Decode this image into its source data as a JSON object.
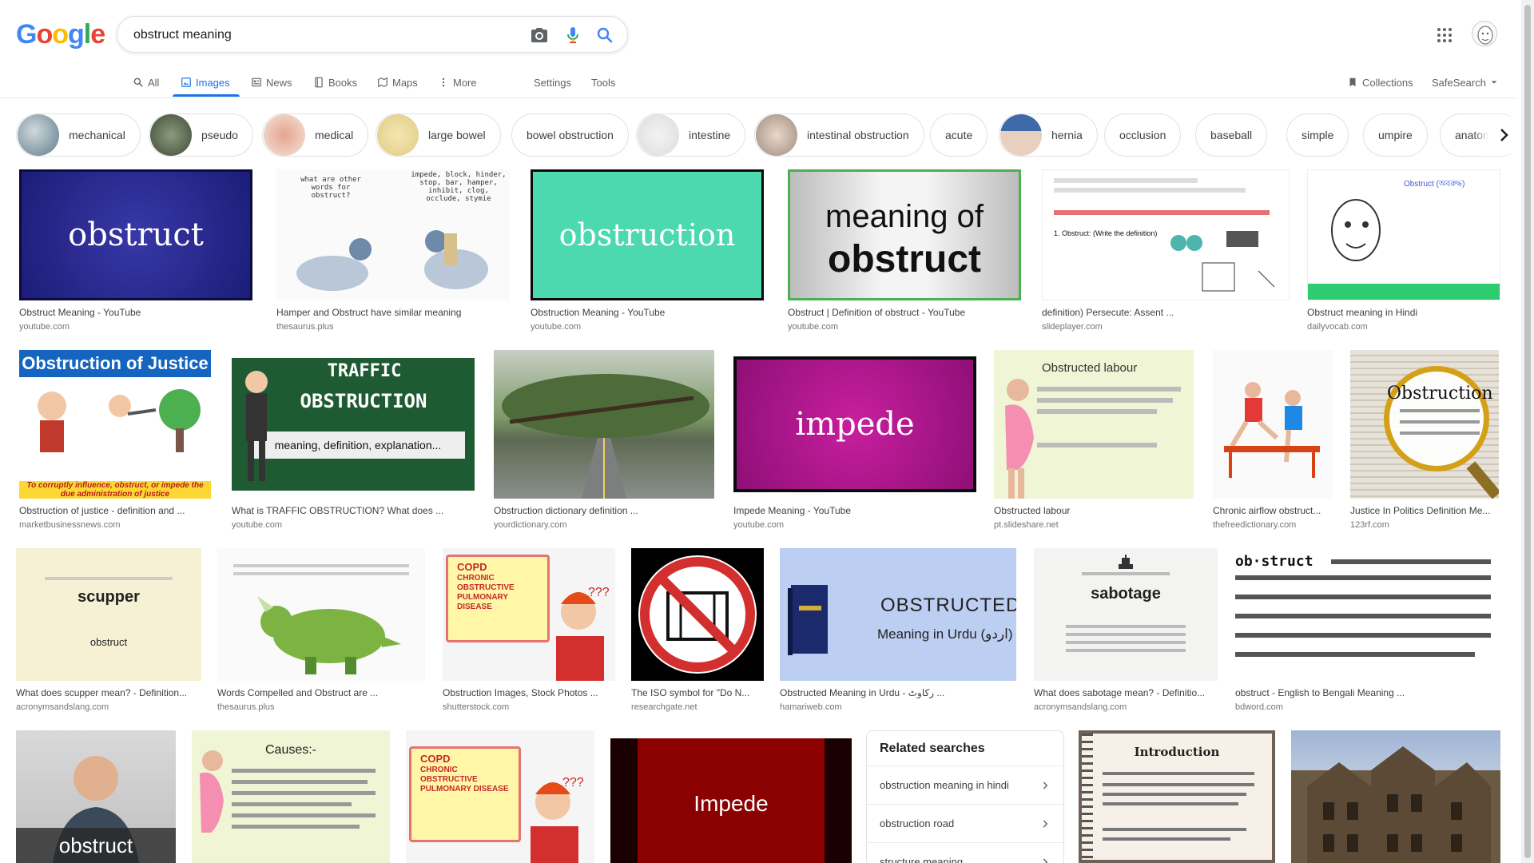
{
  "logo": {
    "text": "Google"
  },
  "search": {
    "query": "obstruct meaning",
    "placeholder": ""
  },
  "nav": {
    "tabs": [
      {
        "label": "All",
        "icon": "search-icon"
      },
      {
        "label": "Images",
        "icon": "image-icon",
        "active": true
      },
      {
        "label": "News",
        "icon": "news-icon"
      },
      {
        "label": "Books",
        "icon": "book-icon"
      },
      {
        "label": "Maps",
        "icon": "map-icon"
      },
      {
        "label": "More",
        "icon": "more-vert-icon"
      }
    ],
    "settings": "Settings",
    "tools": "Tools",
    "collections": "Collections",
    "safesearch": "SafeSearch"
  },
  "chips": [
    {
      "label": "mechanical",
      "thumb": true
    },
    {
      "label": "pseudo",
      "thumb": true
    },
    {
      "label": "medical",
      "thumb": true
    },
    {
      "label": "large bowel",
      "thumb": true
    },
    {
      "label": "bowel obstruction",
      "thumb": false
    },
    {
      "label": "intestine",
      "thumb": true
    },
    {
      "label": "intestinal obstruction",
      "thumb": true
    },
    {
      "label": "acute",
      "thumb": false
    },
    {
      "label": "hernia",
      "thumb": true
    },
    {
      "label": "occlusion",
      "thumb": false
    },
    {
      "label": "baseball",
      "thumb": false
    },
    {
      "label": "simple",
      "thumb": false
    },
    {
      "label": "umpire",
      "thumb": false
    },
    {
      "label": "anatomy p",
      "thumb": false
    }
  ],
  "results": [
    {
      "title": "Obstruct Meaning - YouTube",
      "source": "youtube.com",
      "caption": "obstruct"
    },
    {
      "title": "Hamper and Obstruct have similar meaning",
      "source": "thesaurus.plus",
      "caption": "impede, block, hinder, stop, bar, hamper, inhibit, clog, occlude, stymie",
      "caption2": "what are other words for obstruct?"
    },
    {
      "title": "Obstruction Meaning - YouTube",
      "source": "youtube.com",
      "caption": "obstruction"
    },
    {
      "title": "Obstruct | Definition of obstruct - YouTube",
      "source": "youtube.com",
      "caption": "meaning of",
      "caption2": "obstruct"
    },
    {
      "title": "definition) Persecute: Assent ...",
      "source": "slideplayer.com",
      "caption": "1. Obstruct: (Write the definition)"
    },
    {
      "title": "Obstruct meaning in Hindi",
      "source": "dailyvocab.com",
      "caption": "Obstruct (অবরুদ্ধ)"
    },
    {
      "title": "Obstruction of justice - definition and ...",
      "source": "marketbusinessnews.com",
      "caption": "Obstruction of Justice",
      "caption2": "To corruptly influence, obstruct, or impede the due administration of justice"
    },
    {
      "title": "What is TRAFFIC OBSTRUCTION? What does ...",
      "source": "youtube.com",
      "caption": "TRAFFIC",
      "caption2": "OBSTRUCTION",
      "caption3": "meaning, definition, explanation..."
    },
    {
      "title": "Obstruction dictionary definition ...",
      "source": "yourdictionary.com"
    },
    {
      "title": "Impede Meaning - YouTube",
      "source": "youtube.com",
      "caption": "impede"
    },
    {
      "title": "Obstructed labour",
      "source": "pt.slideshare.net",
      "caption": "Obstructed labour"
    },
    {
      "title": "Chronic airflow obstruct...",
      "source": "thefreedictionary.com"
    },
    {
      "title": "Justice In Politics Definition Me...",
      "source": "123rf.com",
      "caption": "Obstruction"
    },
    {
      "title": "What does scupper mean? - Definition...",
      "source": "acronymsandslang.com",
      "caption": "scupper",
      "caption2": "obstruct"
    },
    {
      "title": "Words Compelled and Obstruct are ...",
      "source": "thesaurus.plus"
    },
    {
      "title": "Obstruction Images, Stock Photos ...",
      "source": "shutterstock.com",
      "caption": "COPD",
      "caption2": "CHRONIC OBSTRUCTIVE PULMONARY DISEASE"
    },
    {
      "title": "The ISO symbol for \"Do N...",
      "source": "researchgate.net"
    },
    {
      "title": "Obstructed Meaning in Urdu - رکاوٹ ...",
      "source": "hamariweb.com",
      "caption": "OBSTRUCTED",
      "caption2": "Meaning in Urdu (اردو)"
    },
    {
      "title": "What does sabotage mean? - Definitio...",
      "source": "acronymsandslang.com",
      "caption": "sabotage"
    },
    {
      "title": "obstruct - English to Bengali Meaning ...",
      "source": "bdword.com",
      "caption": "ob·struct"
    },
    {
      "caption": "obstruct"
    },
    {
      "caption": "Causes:-"
    },
    {
      "caption": "COPD",
      "caption2": "CHRONIC OBSTRUCTIVE PULMONARY DISEASE"
    },
    {
      "caption": "Impede"
    },
    {
      "caption": "Introduction"
    },
    {}
  ],
  "related": {
    "title": "Related searches",
    "items": [
      "obstruction meaning in hindi",
      "obstruction road",
      "structure meaning"
    ]
  }
}
